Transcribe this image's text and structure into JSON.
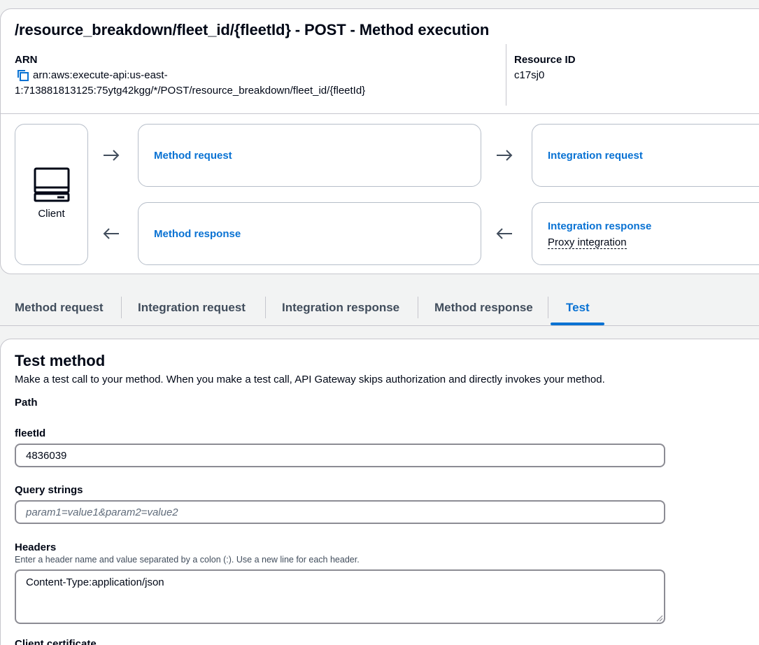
{
  "header": {
    "title": "/resource_breakdown/fleet_id/{fleetId} - POST - Method execution",
    "arn_label": "ARN",
    "arn_line1": "arn:aws:execute-api:us-east-",
    "arn_line2": "1:713881813125:75ytg42kgg/*/POST/resource_breakdown/fleet_id/{fleetId}",
    "resource_id_label": "Resource ID",
    "resource_id_value": "c17sj0"
  },
  "flow": {
    "client_label": "Client",
    "method_request": "Method request",
    "method_response": "Method response",
    "integration_request": "Integration request",
    "integration_response": "Integration response",
    "integration_response_sub": "Proxy integration"
  },
  "tabs": [
    {
      "label": "Method request"
    },
    {
      "label": "Integration request"
    },
    {
      "label": "Integration response"
    },
    {
      "label": "Method response"
    },
    {
      "label": "Test"
    }
  ],
  "active_tab": "Test",
  "test": {
    "title": "Test method",
    "description": "Make a test call to your method. When you make a test call, API Gateway skips authorization and directly invokes your method.",
    "path_label": "Path",
    "fleet_label": "fleetId",
    "fleet_value": "4836039",
    "query_label": "Query strings",
    "query_placeholder": "param1=value1&param2=value2",
    "headers_label": "Headers",
    "headers_hint": "Enter a header name and value separated by a colon (:). Use a new line for each header.",
    "headers_value": "Content-Type:application/json",
    "client_cert_label": "Client certificate"
  },
  "colors": {
    "link": "#0972d3",
    "text": "#000716",
    "muted": "#414d5c",
    "border": "#c6c6cd"
  }
}
